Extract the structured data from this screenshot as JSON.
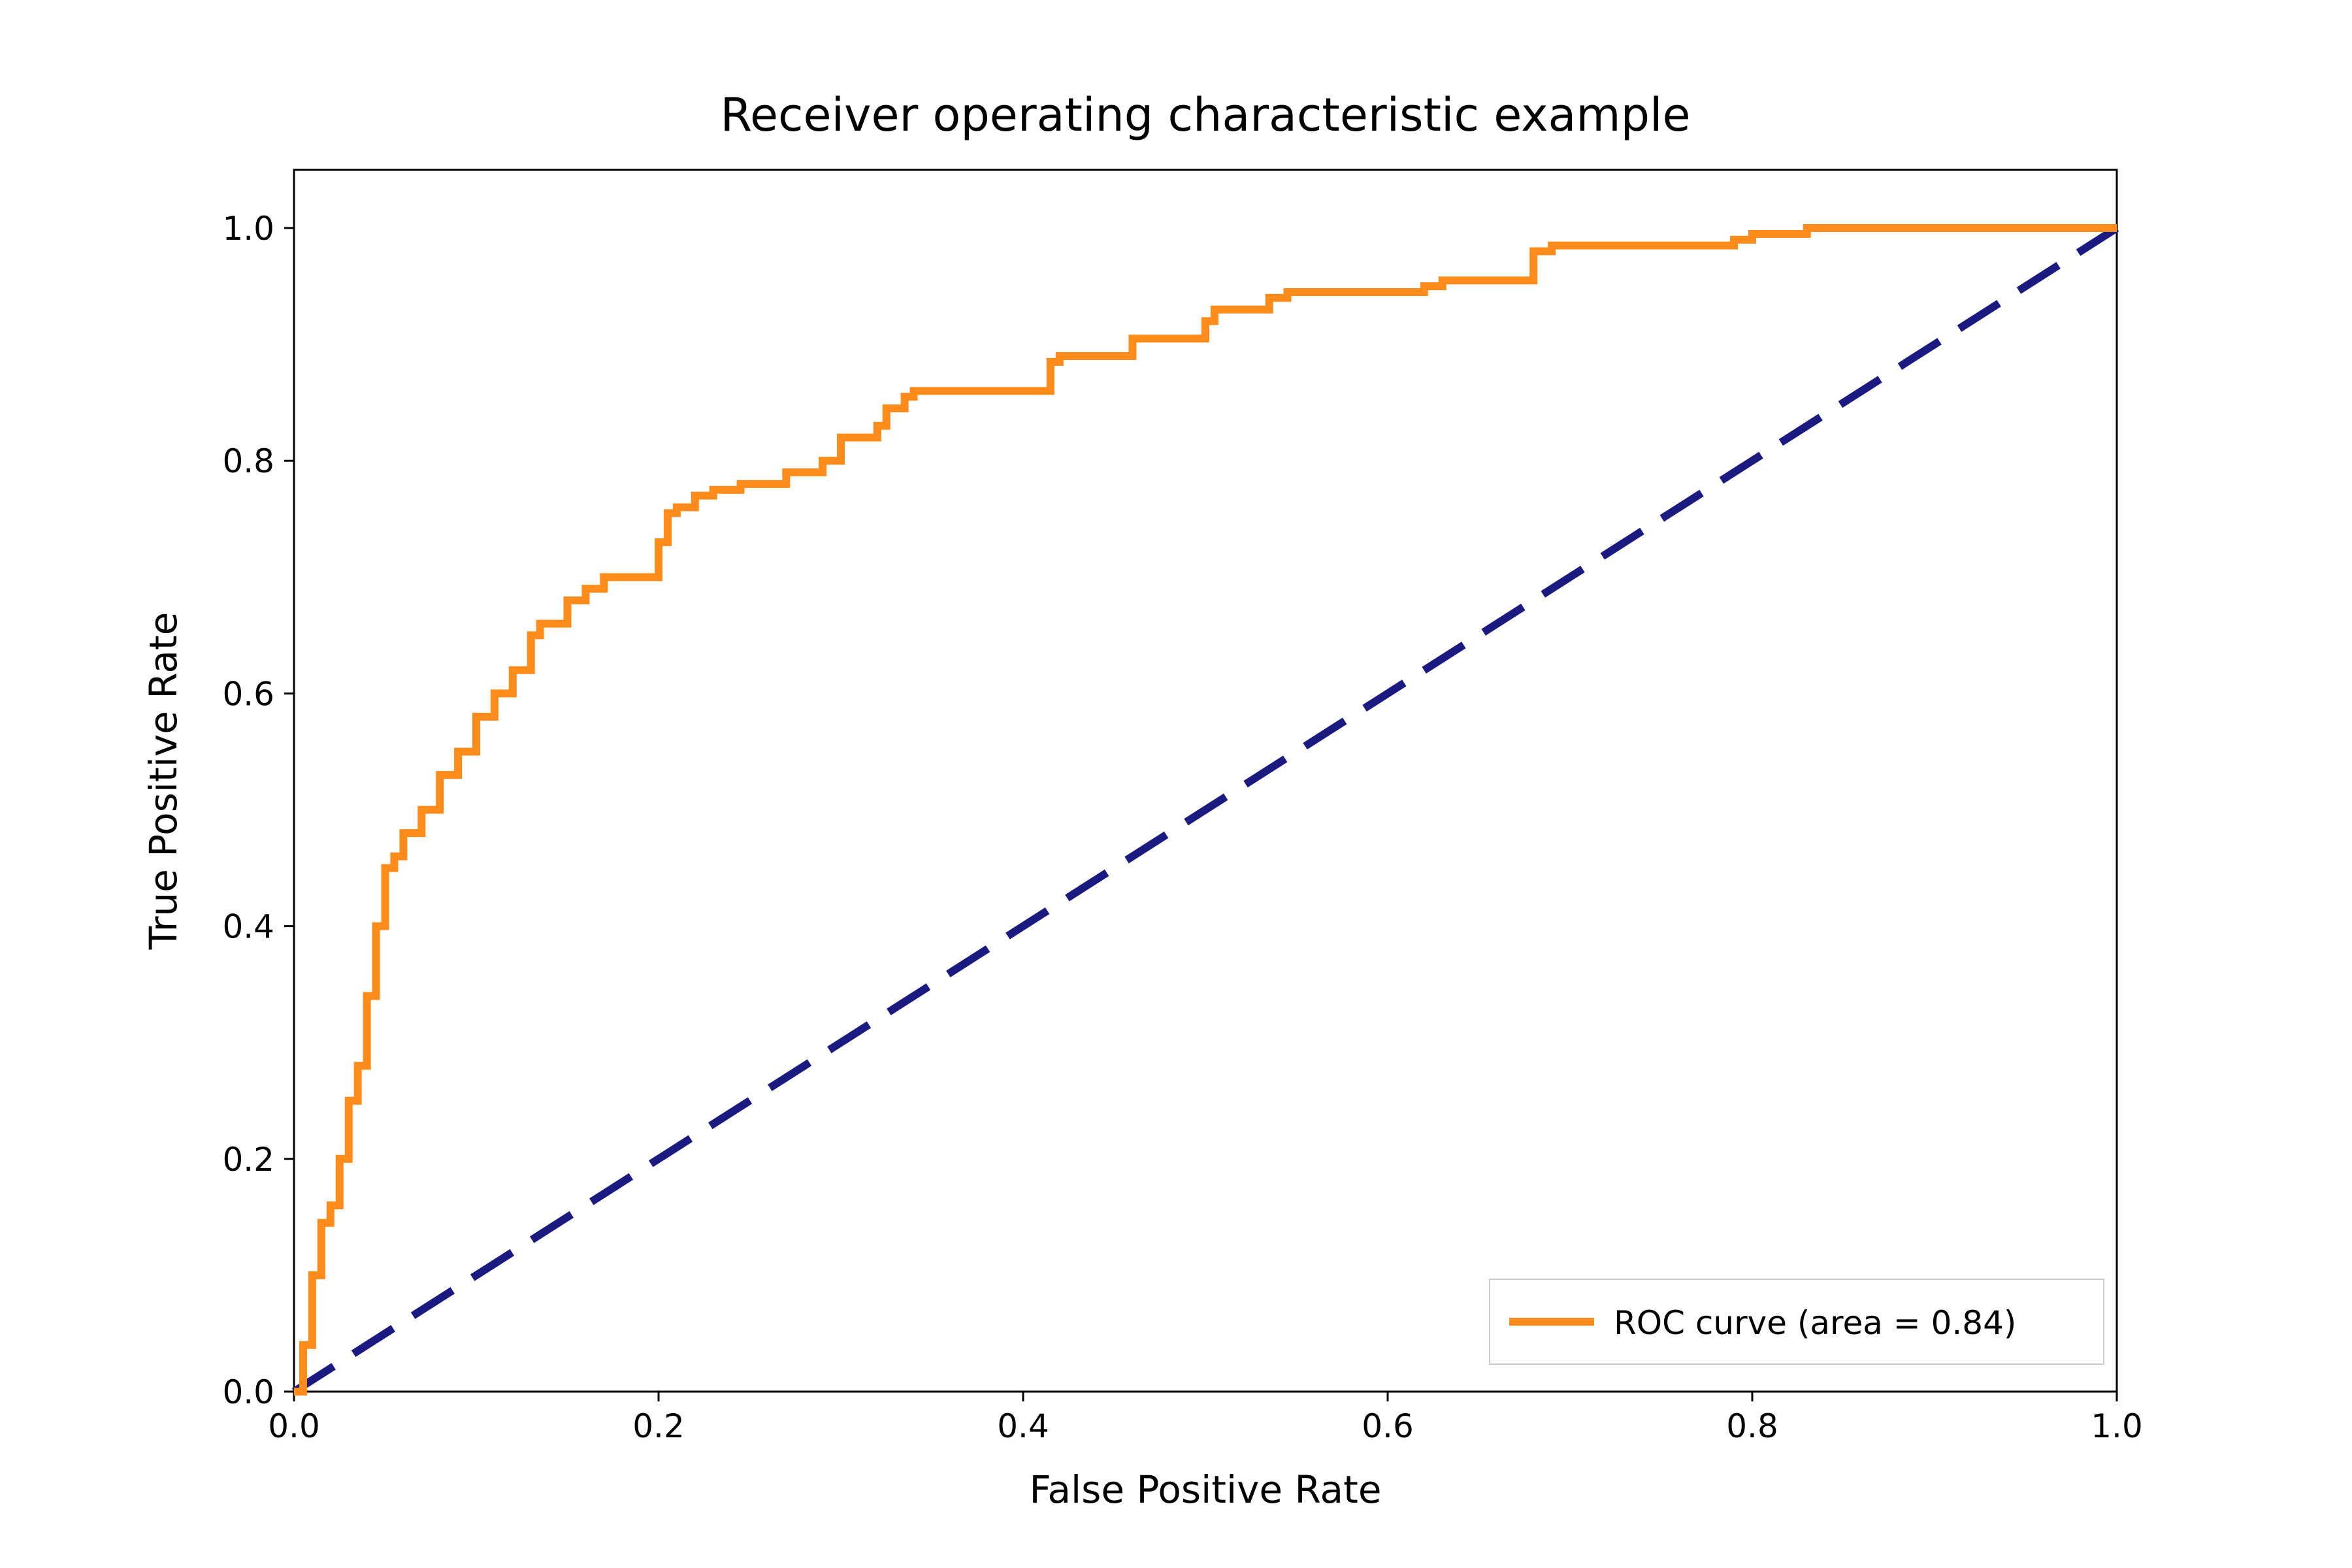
{
  "chart_data": {
    "type": "line",
    "title": "Receiver operating characteristic example",
    "xlabel": "False Positive Rate",
    "ylabel": "True Positive Rate",
    "xlim": [
      0.0,
      1.0
    ],
    "ylim": [
      0.0,
      1.05
    ],
    "xticks": [
      0.0,
      0.2,
      0.4,
      0.6,
      0.8,
      1.0
    ],
    "yticks": [
      0.0,
      0.2,
      0.4,
      0.6,
      0.8,
      1.0
    ],
    "xtick_labels": [
      "0.0",
      "0.2",
      "0.4",
      "0.6",
      "0.8",
      "1.0"
    ],
    "ytick_labels": [
      "0.0",
      "0.2",
      "0.4",
      "0.6",
      "0.8",
      "1.0"
    ],
    "series": [
      {
        "name": "ROC curve (area = 0.84)",
        "color": "#ff8c1a",
        "x": [
          0.0,
          0.005,
          0.005,
          0.01,
          0.01,
          0.015,
          0.015,
          0.02,
          0.02,
          0.025,
          0.025,
          0.03,
          0.03,
          0.035,
          0.035,
          0.04,
          0.04,
          0.045,
          0.045,
          0.05,
          0.05,
          0.055,
          0.055,
          0.06,
          0.06,
          0.07,
          0.07,
          0.08,
          0.08,
          0.09,
          0.09,
          0.1,
          0.1,
          0.11,
          0.11,
          0.12,
          0.12,
          0.13,
          0.13,
          0.135,
          0.135,
          0.15,
          0.15,
          0.16,
          0.16,
          0.17,
          0.17,
          0.2,
          0.2,
          0.205,
          0.205,
          0.21,
          0.21,
          0.22,
          0.22,
          0.23,
          0.23,
          0.245,
          0.245,
          0.27,
          0.27,
          0.29,
          0.29,
          0.3,
          0.3,
          0.32,
          0.32,
          0.325,
          0.325,
          0.335,
          0.335,
          0.34,
          0.34,
          0.415,
          0.415,
          0.42,
          0.42,
          0.46,
          0.46,
          0.5,
          0.5,
          0.505,
          0.505,
          0.535,
          0.535,
          0.545,
          0.545,
          0.62,
          0.62,
          0.63,
          0.63,
          0.68,
          0.68,
          0.69,
          0.69,
          0.79,
          0.79,
          0.8,
          0.8,
          0.83,
          0.83,
          1.0
        ],
        "y": [
          0.0,
          0.0,
          0.04,
          0.04,
          0.1,
          0.1,
          0.145,
          0.145,
          0.16,
          0.16,
          0.2,
          0.2,
          0.25,
          0.25,
          0.28,
          0.28,
          0.34,
          0.34,
          0.4,
          0.4,
          0.45,
          0.45,
          0.46,
          0.46,
          0.48,
          0.48,
          0.5,
          0.5,
          0.53,
          0.53,
          0.55,
          0.55,
          0.58,
          0.58,
          0.6,
          0.6,
          0.62,
          0.62,
          0.65,
          0.65,
          0.66,
          0.66,
          0.68,
          0.68,
          0.69,
          0.69,
          0.7,
          0.7,
          0.73,
          0.73,
          0.755,
          0.755,
          0.76,
          0.76,
          0.77,
          0.77,
          0.775,
          0.775,
          0.78,
          0.78,
          0.79,
          0.79,
          0.8,
          0.8,
          0.82,
          0.82,
          0.83,
          0.83,
          0.845,
          0.845,
          0.855,
          0.855,
          0.86,
          0.86,
          0.885,
          0.885,
          0.89,
          0.89,
          0.905,
          0.905,
          0.92,
          0.92,
          0.93,
          0.93,
          0.94,
          0.94,
          0.945,
          0.945,
          0.95,
          0.95,
          0.955,
          0.955,
          0.98,
          0.98,
          0.985,
          0.985,
          0.99,
          0.99,
          0.995,
          0.995,
          1.0,
          1.0
        ]
      },
      {
        "name": "diagonal",
        "color": "#1a1a80",
        "style": "dashed",
        "x": [
          0.0,
          1.0
        ],
        "y": [
          0.0,
          1.0
        ]
      }
    ],
    "legend": {
      "position": "lower right",
      "entries": [
        "ROC curve (area = 0.84)"
      ]
    },
    "area_under_curve": 0.84
  }
}
